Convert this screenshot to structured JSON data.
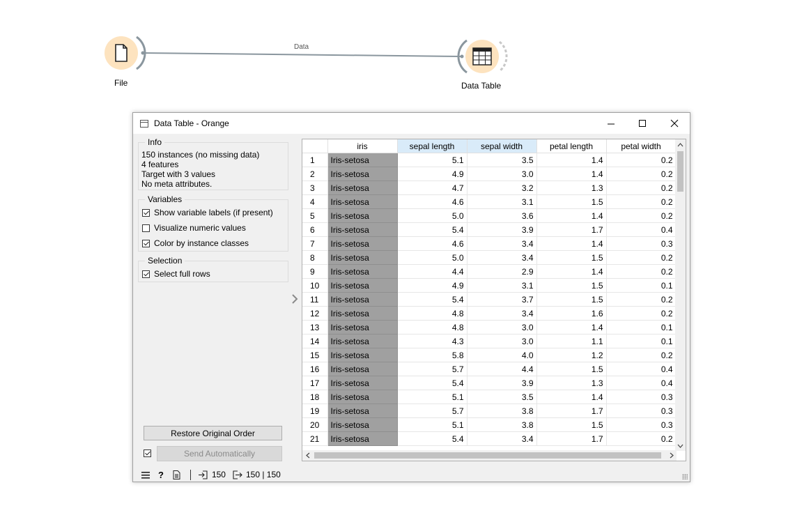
{
  "workflow": {
    "file_node": {
      "label": "File",
      "icon": "document-icon"
    },
    "table_node": {
      "label": "Data Table",
      "icon": "table-icon"
    },
    "link_label": "Data",
    "node_color": "#fde3bf"
  },
  "window": {
    "title": "Data Table - Orange",
    "controls": {
      "minimize": "—",
      "maximize": "☐",
      "close": "✕"
    }
  },
  "info": {
    "title": "Info",
    "lines": [
      "150 instances (no missing data)",
      "4 features",
      "Target with 3 values",
      "No meta attributes."
    ]
  },
  "variables": {
    "title": "Variables",
    "options": [
      {
        "label": "Show variable labels (if present)",
        "checked": true
      },
      {
        "label": "Visualize numeric values",
        "checked": false
      },
      {
        "label": "Color by instance classes",
        "checked": true
      }
    ]
  },
  "selection": {
    "title": "Selection",
    "options": [
      {
        "label": "Select full rows",
        "checked": true
      }
    ]
  },
  "buttons": {
    "restore": "Restore Original Order",
    "send": "Send Automatically",
    "send_auto_checked": true
  },
  "table": {
    "columns": [
      "iris",
      "sepal length",
      "sepal width",
      "petal length",
      "petal width"
    ],
    "highlight_columns": [
      "sepal length",
      "sepal width"
    ],
    "class_color": "#a0a0a0",
    "rows": [
      [
        "1",
        "Iris-setosa",
        "5.1",
        "3.5",
        "1.4",
        "0.2"
      ],
      [
        "2",
        "Iris-setosa",
        "4.9",
        "3.0",
        "1.4",
        "0.2"
      ],
      [
        "3",
        "Iris-setosa",
        "4.7",
        "3.2",
        "1.3",
        "0.2"
      ],
      [
        "4",
        "Iris-setosa",
        "4.6",
        "3.1",
        "1.5",
        "0.2"
      ],
      [
        "5",
        "Iris-setosa",
        "5.0",
        "3.6",
        "1.4",
        "0.2"
      ],
      [
        "6",
        "Iris-setosa",
        "5.4",
        "3.9",
        "1.7",
        "0.4"
      ],
      [
        "7",
        "Iris-setosa",
        "4.6",
        "3.4",
        "1.4",
        "0.3"
      ],
      [
        "8",
        "Iris-setosa",
        "5.0",
        "3.4",
        "1.5",
        "0.2"
      ],
      [
        "9",
        "Iris-setosa",
        "4.4",
        "2.9",
        "1.4",
        "0.2"
      ],
      [
        "10",
        "Iris-setosa",
        "4.9",
        "3.1",
        "1.5",
        "0.1"
      ],
      [
        "11",
        "Iris-setosa",
        "5.4",
        "3.7",
        "1.5",
        "0.2"
      ],
      [
        "12",
        "Iris-setosa",
        "4.8",
        "3.4",
        "1.6",
        "0.2"
      ],
      [
        "13",
        "Iris-setosa",
        "4.8",
        "3.0",
        "1.4",
        "0.1"
      ],
      [
        "14",
        "Iris-setosa",
        "4.3",
        "3.0",
        "1.1",
        "0.1"
      ],
      [
        "15",
        "Iris-setosa",
        "5.8",
        "4.0",
        "1.2",
        "0.2"
      ],
      [
        "16",
        "Iris-setosa",
        "5.7",
        "4.4",
        "1.5",
        "0.4"
      ],
      [
        "17",
        "Iris-setosa",
        "5.4",
        "3.9",
        "1.3",
        "0.4"
      ],
      [
        "18",
        "Iris-setosa",
        "5.1",
        "3.5",
        "1.4",
        "0.3"
      ],
      [
        "19",
        "Iris-setosa",
        "5.7",
        "3.8",
        "1.7",
        "0.3"
      ],
      [
        "20",
        "Iris-setosa",
        "5.1",
        "3.8",
        "1.5",
        "0.3"
      ],
      [
        "21",
        "Iris-setosa",
        "5.4",
        "3.4",
        "1.7",
        "0.2"
      ]
    ]
  },
  "status": {
    "input_count": "150",
    "output_count": "150 | 150"
  }
}
